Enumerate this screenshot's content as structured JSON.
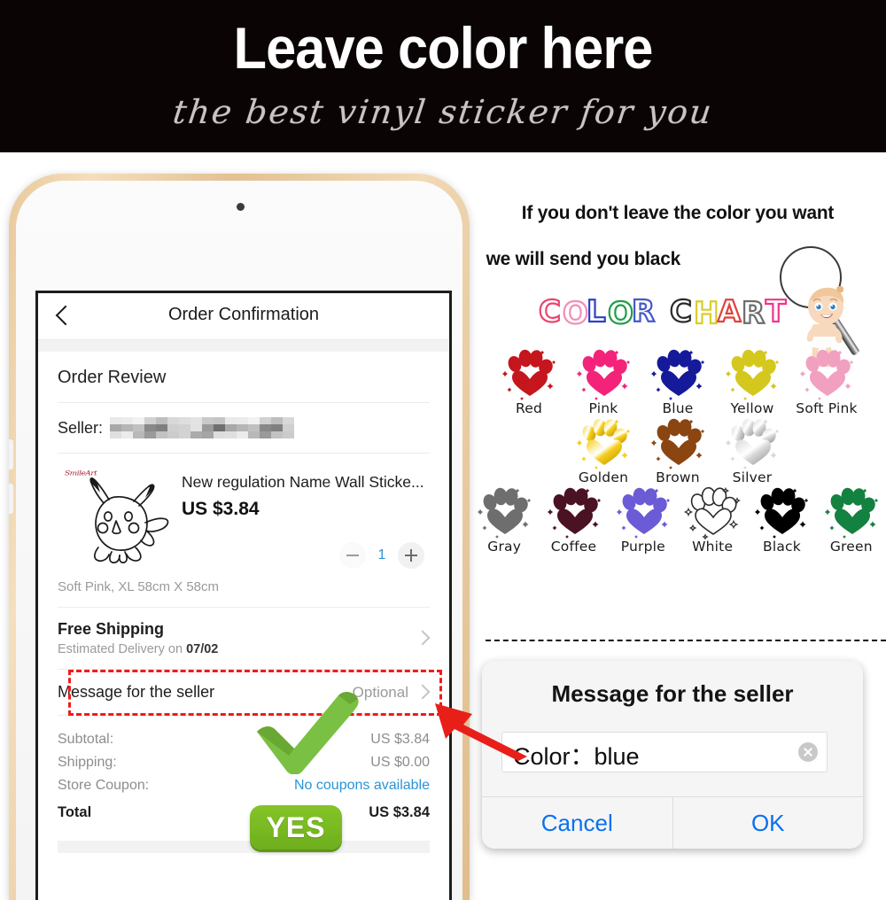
{
  "banner": {
    "title": "Leave color here",
    "subtitle": "the best vinyl sticker for you"
  },
  "phone": {
    "nav": {
      "back_icon": "chevron-left-icon",
      "title": "Order Confirmation"
    },
    "order_review_heading": "Order Review",
    "seller": {
      "label": "Seller:",
      "value_masked": ""
    },
    "product": {
      "watermark": "SmileArt",
      "title": "New regulation Name Wall Sticke...",
      "price": "US $3.84",
      "variant": "Soft Pink, XL 58cm X 58cm",
      "quantity": "1",
      "minus_icon": "minus-icon",
      "plus_icon": "plus-icon"
    },
    "shipping": {
      "title": "Free Shipping",
      "estimate_prefix": "Estimated Delivery on ",
      "estimate_date": "07/02",
      "chevron_icon": "chevron-right-icon"
    },
    "message_row": {
      "label": "Message for the seller",
      "value": "Optional",
      "chevron_icon": "chevron-right-icon"
    },
    "totals": [
      {
        "label": "Subtotal:",
        "value": "US $3.84",
        "link": false
      },
      {
        "label": "Shipping:",
        "value": "US $0.00",
        "link": false
      },
      {
        "label": "Store Coupon:",
        "value": "No coupons available",
        "link": true
      },
      {
        "label": "Total",
        "value": "US $3.84",
        "link": false
      }
    ],
    "yes_badge": "YES",
    "check_icon": "green-check-icon"
  },
  "right": {
    "headline_line1": "If you don't leave the color you want",
    "headline_line2": "we will send you black",
    "chart_word": "COLOR CHART",
    "chart_word_letters": [
      {
        "char": "C",
        "color": "#e8456d"
      },
      {
        "char": "O",
        "color": "#f08fb8"
      },
      {
        "char": "L",
        "color": "#2f3fc4"
      },
      {
        "char": "O",
        "color": "#1f9e4a"
      },
      {
        "char": "R",
        "color": "#4558c8"
      },
      {
        "char": " ",
        "color": "#ffffff"
      },
      {
        "char": "C",
        "color": "#2a2a2a"
      },
      {
        "char": "H",
        "color": "#d8cf2a"
      },
      {
        "char": "A",
        "color": "#e0403c"
      },
      {
        "char": "R",
        "color": "#6d6d6d"
      },
      {
        "char": "T",
        "color": "#f0368a"
      }
    ],
    "magnifier_icon": "magnifying-glass-icon",
    "baby_icon": "cartoon-baby-icon",
    "paw_rows": [
      [
        {
          "name": "Red",
          "fill": "#c4161c",
          "type": "solid",
          "stroke": "none"
        },
        {
          "name": "Pink",
          "fill": "#f3237a",
          "type": "solid",
          "stroke": "none"
        },
        {
          "name": "Blue",
          "fill": "#141a99",
          "type": "solid",
          "stroke": "none"
        },
        {
          "name": "Yellow",
          "fill": "#d4c81e",
          "type": "solid",
          "stroke": "none"
        },
        {
          "name": "Soft Pink",
          "fill": "#f2a0c0",
          "type": "solid",
          "stroke": "none"
        }
      ],
      [
        {
          "name": "Golden",
          "fill": "#f5cf1a",
          "fill2": "#b88a06",
          "type": "gradient",
          "stroke": "none"
        },
        {
          "name": "Brown",
          "fill": "#8a4511",
          "type": "solid",
          "stroke": "none"
        },
        {
          "name": "Silver",
          "fill": "#d9d9d9",
          "fill2": "#8c8c8c",
          "type": "gradient",
          "stroke": "none"
        }
      ],
      [
        {
          "name": "Gray",
          "fill": "#6e6e6e",
          "type": "solid",
          "stroke": "none"
        },
        {
          "name": "Coffee",
          "fill": "#4a1222",
          "type": "solid",
          "stroke": "none"
        },
        {
          "name": "Purple",
          "fill": "#6b5bd6",
          "type": "solid",
          "stroke": "none"
        },
        {
          "name": "White",
          "fill": "#ffffff",
          "type": "solid",
          "stroke": "#2b2b2b"
        },
        {
          "name": "Black",
          "fill": "#000000",
          "type": "solid",
          "stroke": "none"
        },
        {
          "name": "Green",
          "fill": "#138140",
          "type": "solid",
          "stroke": "none"
        }
      ]
    ],
    "dialog": {
      "title": "Message for the seller",
      "input_value": "Color：blue",
      "clear_icon": "clear-circle-icon",
      "cancel_label": "Cancel",
      "ok_label": "OK"
    },
    "arrow_icon": "red-arrow-icon"
  },
  "colors": {
    "banner_bg": "#0a0405",
    "accent_red": "#ef1b18",
    "accent_green": "#7ac043",
    "link_blue": "#2a94d6",
    "dialog_blue": "#0a70f0"
  }
}
